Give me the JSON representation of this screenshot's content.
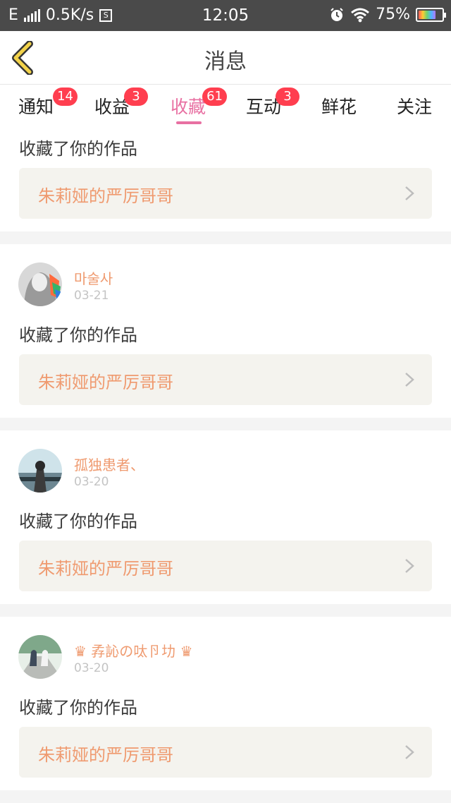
{
  "status_bar": {
    "network": "E",
    "speed": "0.5K/s",
    "sim_label": "S",
    "time": "12:05",
    "battery": "75%",
    "battery_level": 0.75
  },
  "header": {
    "title": "消息"
  },
  "tabs": [
    {
      "label": "通知",
      "badge": "14",
      "active": false
    },
    {
      "label": "收益",
      "badge": "3",
      "active": false
    },
    {
      "label": "收藏",
      "badge": "61",
      "active": true
    },
    {
      "label": "互动",
      "badge": "3",
      "active": false
    },
    {
      "label": "鲜花",
      "badge": "",
      "active": false
    },
    {
      "label": "关注",
      "badge": "",
      "active": false
    }
  ],
  "notifications": [
    {
      "user": "",
      "date": "",
      "action": "收藏了你的作品",
      "work": "朱莉娅的严厉哥哥"
    },
    {
      "user": "마술사",
      "date": "03-21",
      "action": "收藏了你的作品",
      "work": "朱莉娅的严厉哥哥"
    },
    {
      "user": "孤独患者、",
      "date": "03-20",
      "action": "收藏了你的作品",
      "work": "朱莉娅的严厉哥哥"
    },
    {
      "user": "♛ 孨訫の呔卪㘦 ♛",
      "date": "03-20",
      "action": "收藏了你的作品",
      "work": "朱莉娅的严厉哥哥"
    }
  ],
  "colors": {
    "accent": "#e870a2",
    "badge": "#ff3e4f",
    "username": "#ef9a6f",
    "status_bar": "#4a4a4a"
  },
  "icons": {
    "back": "chevron-left-icon",
    "row_arrow": "chevron-right-icon"
  }
}
